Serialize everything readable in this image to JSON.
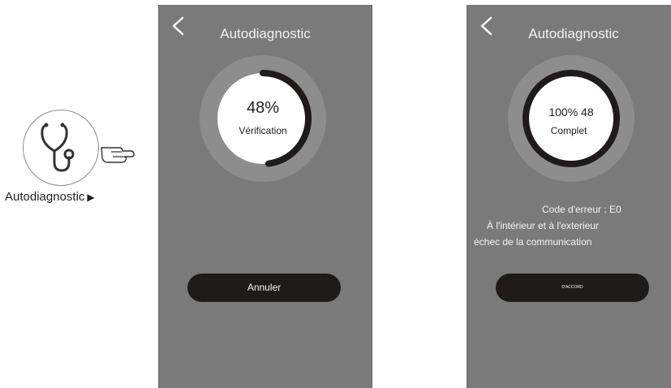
{
  "side_illustration": {
    "label": "Autodiagnostic",
    "arrow": "▶",
    "icons": [
      "stethoscope-icon",
      "pointing-hand-icon"
    ]
  },
  "left_screen": {
    "title": "Autodiagnostic",
    "back_icon": "chevron-left-icon",
    "progress_text": "48%",
    "progress_fraction": 0.48,
    "status": "Vérification",
    "button_label": "Annuler"
  },
  "right_screen": {
    "title": "Autodiagnostic",
    "back_icon": "chevron-left-icon",
    "progress_text": "100% 48",
    "progress_fraction": 1.0,
    "status": "Complet",
    "error_lines": [
      "Code d'erreur : E0",
      "À l'intérieur et à l'exterieur",
      "échec de la communication"
    ],
    "button_label": "D'ACCORD"
  },
  "colors": {
    "screen_bg": "#7a7a7a",
    "ring_bg": "#8d8d8d",
    "progress_arc": "#1f1b1b",
    "button_bg": "#1f1b1b"
  }
}
